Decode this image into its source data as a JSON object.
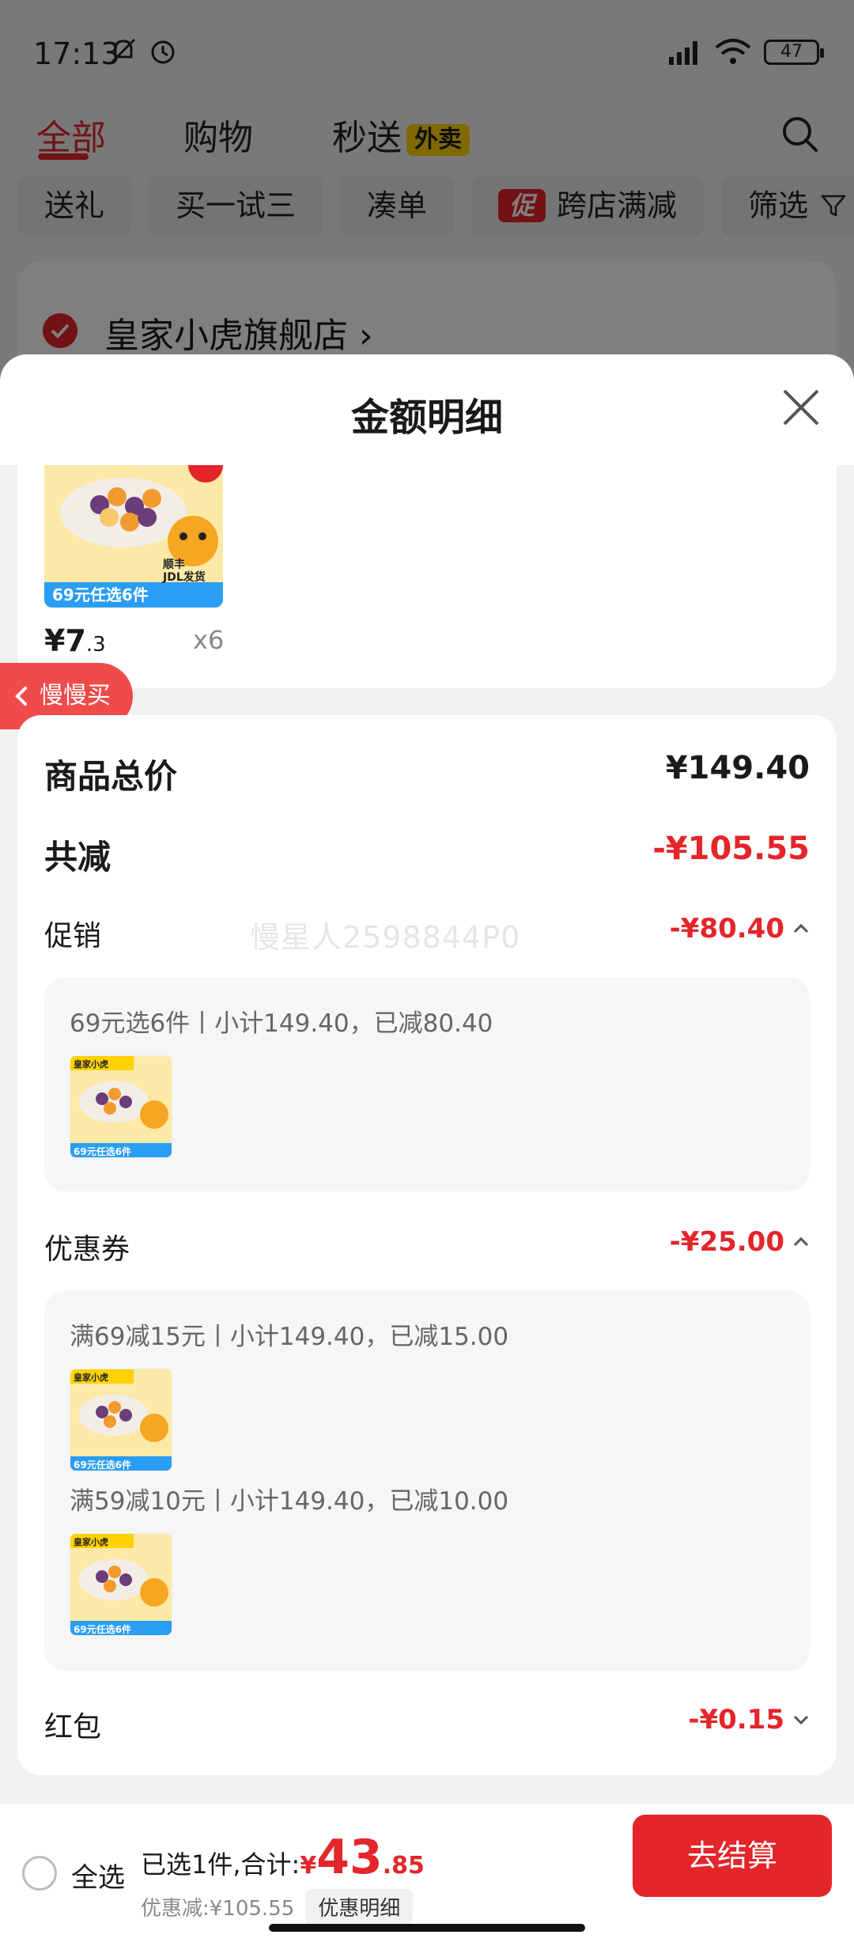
{
  "status_bar": {
    "time": "17:13",
    "battery": "47",
    "icons_left": [
      "mute-bell-icon",
      "alarm-icon"
    ],
    "icons_right": [
      "hd-signal-icon",
      "wifi-icon",
      "battery-icon"
    ]
  },
  "top_tabs": {
    "all": "全部",
    "shopping": "购物",
    "fast_delivery": "秒送",
    "waimai_badge": "外卖"
  },
  "chips": {
    "gift": "送礼",
    "buy_one_try_three": "买一试三",
    "make_order": "凑单",
    "promo_icon": "促",
    "cross_store": "跨店满减",
    "filter": "筛选"
  },
  "store": {
    "name": "皇家小虎旗舰店"
  },
  "sheet": {
    "title": "金额明细"
  },
  "product": {
    "price_int": "¥7",
    "price_dec": ".3",
    "qty": "x6",
    "thumb_lines": [
      "69元任选6件",
      "顺丰",
      "JDL发货"
    ]
  },
  "slow_buy": {
    "label": "慢慢买"
  },
  "watermark": "慢星人2598844P0",
  "summary": {
    "total_label": "商品总价",
    "total_value": "¥149.40",
    "reduced_label": "共减",
    "reduced_value": "-¥105.55"
  },
  "promotion": {
    "label": "促销",
    "value": "-¥80.40",
    "line": "69元选6件丨小计149.40，已减80.40"
  },
  "coupon": {
    "label": "优惠券",
    "value": "-¥25.00",
    "line1": "满69减15元丨小计149.40，已减15.00",
    "line2": "满59减10元丨小计149.40，已减10.00"
  },
  "red_packet": {
    "label": "红包",
    "value": "-¥0.15"
  },
  "thumb": {
    "brand": "皇家小虎",
    "tag": "69元任选6件",
    "sf": "顺丰",
    "jdl": "JDL发货"
  },
  "bottom_bar": {
    "select_all": "全选",
    "selected_prefix": "已选1件,合计:",
    "yen": "¥",
    "total_int": "43",
    "total_dec": ".85",
    "discount_text": "优惠减:¥105.55",
    "detail_chip": "优惠明细",
    "checkout": "去结算"
  },
  "colors": {
    "accent_red": "#e4252a",
    "badge_yellow": "#ffd200",
    "slow_buy_red": "#f04b4b"
  }
}
